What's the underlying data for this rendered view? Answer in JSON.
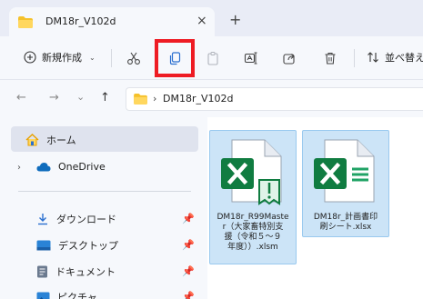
{
  "window": {
    "tab_title": "DM18r_V102d",
    "close_glyph": "×",
    "new_tab_glyph": "+"
  },
  "toolbar": {
    "new_label": "新規作成",
    "new_chevron": "⌄",
    "sort_label": "並べ替え"
  },
  "address": {
    "back": "←",
    "forward": "→",
    "recent": "⌄",
    "up": "↑",
    "sep": "›",
    "breadcrumb": "DM18r_V102d"
  },
  "sidebar": {
    "home": "ホーム",
    "expand": "›",
    "onedrive": "OneDrive",
    "pin": "📌",
    "downloads": "ダウンロード",
    "desktop": "デスクトップ",
    "documents": "ドキュメント",
    "pictures": "ピクチャ"
  },
  "files": [
    {
      "name": "DM18r_R99Master（大家畜特別支援（令和５～９年度））.xlsm",
      "lines": [
        "DM18r_R99Maste",
        "r（大家畜特別支",
        "援（令和５～９",
        "年度））.xlsm"
      ]
    },
    {
      "name": "DM18r_計画書印刷シート.xlsx",
      "lines": [
        "DM18r_計画書印",
        "刷シート.xlsx"
      ]
    }
  ],
  "colors": {
    "highlight": "#ee1c24",
    "excel_green": "#107c41",
    "selection": "#cce4f7",
    "folder": "#f5c12a"
  }
}
